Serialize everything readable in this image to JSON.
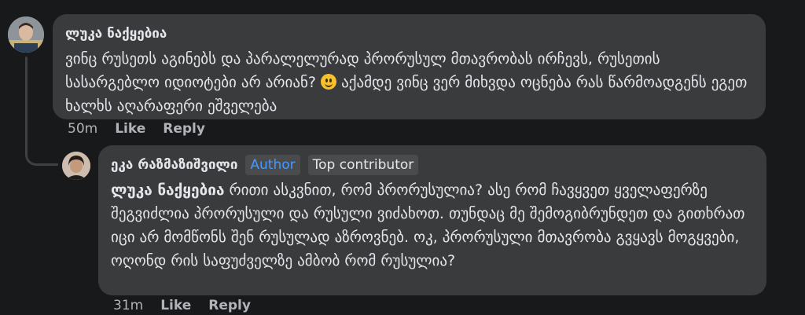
{
  "comments": [
    {
      "author": "ლუკა ნაქყებია",
      "text_before_emoji": "ვინც რუსეთს აგინებს და პარალელურად პრორუსულ მთავრობას ირჩევს, რუსეთის სასარგებლო იდიოტები არ არიან? ",
      "emoji": "slightly-smiling-face",
      "text_after_emoji": " აქამდე ვინც ვერ მიხვდა ოცნება რას წარმოადგენს ეგეთ ხალხს აღარაფერი ეშველება",
      "time": "50m",
      "like_label": "Like",
      "reply_label": "Reply"
    },
    {
      "author": "ეკა რაზმაზიშვილი",
      "badges": [
        "Author",
        "Top contributor"
      ],
      "mention": "ლუკა ნაქყებია",
      "text": " რითი ასკვნით, რომ პრორუსულია? ასე რომ ჩავყვეთ ყველაფერზე შეგვიძლია პრორუსული და რუსული ვიძახოთ. თუნდაც მე შემოგიბრუნდეთ და გითხრათ იცი არ მომწონს შენ რუსულად აზროვნებ. ოკ, პრორუსული მთავრობა გვყავს მოგყვები, ოღონდ რის საფუძველზე ამბობ რომ რუსულია?",
      "time": "31m",
      "like_label": "Like",
      "reply_label": "Reply"
    }
  ],
  "colors": {
    "background": "#18191a",
    "bubble": "#3a3b3c",
    "text": "#e4e6eb",
    "muted": "#b0b3b8",
    "author_badge": "#4599ff"
  }
}
